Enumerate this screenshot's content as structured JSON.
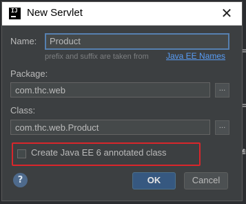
{
  "window": {
    "title": "New Servlet",
    "app_icon": "intellij-icon",
    "app_icon_text": "IJ",
    "close_glyph": "✕"
  },
  "form": {
    "name_label": "Name:",
    "name_value": "Product",
    "hint": "prefix and suffix are taken from",
    "hint_link": "Java EE Names",
    "package_label": "Package:",
    "package_value": "com.thc.web",
    "class_label": "Class:",
    "class_value": "com.thc.web.Product",
    "browse_glyph": "..."
  },
  "checkbox": {
    "label": "Create Java EE 6 annotated class",
    "checked": false
  },
  "buttons": {
    "help_glyph": "?",
    "ok": "OK",
    "cancel": "Cancel"
  },
  "colors": {
    "highlight_border": "#d9262b",
    "link": "#589df6",
    "ok_bg": "#365880"
  }
}
